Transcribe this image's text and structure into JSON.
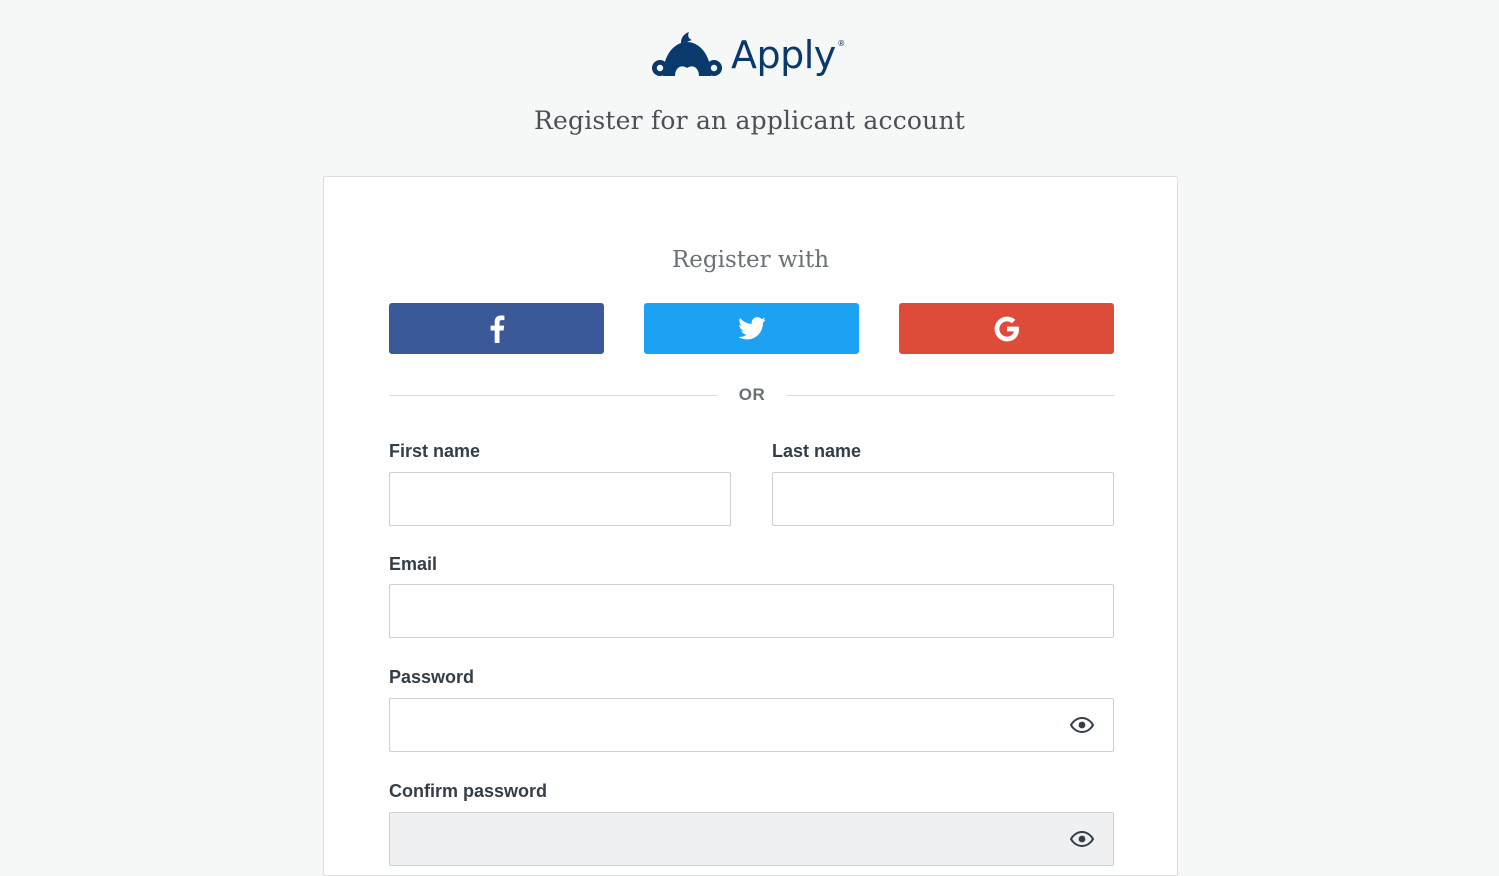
{
  "brand": {
    "name": "Apply",
    "registered_mark": "®",
    "color": "#0a3a6b"
  },
  "page": {
    "subtitle": "Register for an applicant account"
  },
  "register": {
    "heading": "Register with",
    "social": [
      {
        "provider": "facebook",
        "icon": "facebook-icon",
        "color": "#3b5998"
      },
      {
        "provider": "twitter",
        "icon": "twitter-icon",
        "color": "#1da1f2"
      },
      {
        "provider": "google",
        "icon": "google-icon",
        "color": "#dd4b39"
      }
    ],
    "separator": "OR"
  },
  "form": {
    "first_name": {
      "label": "First name",
      "value": "",
      "placeholder": ""
    },
    "last_name": {
      "label": "Last name",
      "value": "",
      "placeholder": ""
    },
    "email": {
      "label": "Email",
      "value": "",
      "placeholder": ""
    },
    "password": {
      "label": "Password",
      "value": "",
      "placeholder": "",
      "toggle_icon": "eye-icon"
    },
    "confirm_password": {
      "label": "Confirm password",
      "value": "",
      "placeholder": "",
      "toggle_icon": "eye-icon"
    }
  }
}
